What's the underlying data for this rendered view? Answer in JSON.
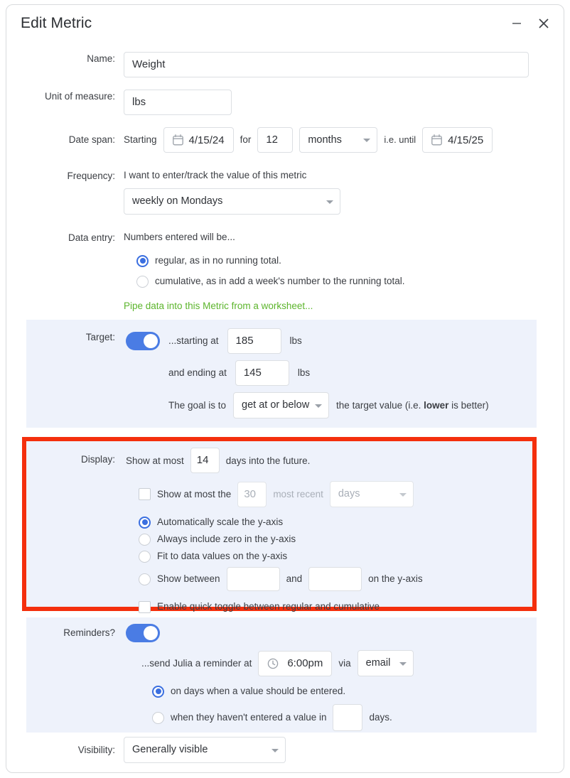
{
  "window": {
    "title": "Edit Metric",
    "minimize_icon": "minimize-icon",
    "close_icon": "close-icon"
  },
  "form": {
    "name": {
      "label": "Name:",
      "value": "Weight"
    },
    "unit": {
      "label": "Unit of measure:",
      "value": "lbs"
    },
    "date_span": {
      "label": "Date span:",
      "starting_text": "Starting",
      "start_date": "4/15/24",
      "for_text": "for",
      "duration": "12",
      "duration_unit": "months",
      "until_text": "i.e. until",
      "end_date": "4/15/25",
      "calendar_icon": "calendar-icon"
    },
    "frequency": {
      "label": "Frequency:",
      "description": "I want to enter/track the value of this metric",
      "value": "weekly on Mondays"
    },
    "data_entry": {
      "label": "Data entry:",
      "description": "Numbers entered will be...",
      "option_regular": "regular, as in no running total.",
      "option_cumulative": "cumulative, as in add a week's number to the running total.",
      "selected": "regular",
      "pipe_link": "Pipe data into this Metric from a worksheet..."
    },
    "target": {
      "label": "Target:",
      "enabled": true,
      "starting_text": "...starting at",
      "starting_value": "185",
      "starting_unit": "lbs",
      "ending_text": "and ending at",
      "ending_value": "145",
      "ending_unit": "lbs",
      "goal_text": "The goal is to",
      "goal_value": "get at or below",
      "goal_suffix_pre": "the target value (i.e. ",
      "goal_suffix_bold": "lower",
      "goal_suffix_post": " is better)"
    },
    "display": {
      "label": "Display:",
      "future_prefix": "Show at most",
      "future_days": "14",
      "future_suffix": "days into the future.",
      "recent_checkbox_checked": false,
      "recent_prefix": "Show at most the",
      "recent_count": "30",
      "recent_middle": "most recent",
      "recent_unit": "days",
      "yaxis_selected": "auto",
      "yaxis_auto": "Automatically scale the y-axis",
      "yaxis_zero": "Always include zero in the y-axis",
      "yaxis_fit": "Fit to data values on the y-axis",
      "yaxis_between_prefix": "Show between",
      "yaxis_between_min": "",
      "yaxis_between_and": "and",
      "yaxis_between_max": "",
      "yaxis_between_suffix": "on the y-axis",
      "quick_toggle_checked": false,
      "quick_toggle_label": "Enable quick toggle between regular and cumulative"
    },
    "reminders": {
      "label": "Reminders?",
      "enabled": true,
      "send_prefix": "...send Julia a reminder at",
      "time": "6:00pm",
      "via_text": "via",
      "channel": "email",
      "clock_icon": "clock-icon",
      "option_on_days": "on days when a value should be entered.",
      "option_not_entered_prefix": "when they haven't entered a value in",
      "option_not_entered_days": "",
      "option_not_entered_suffix": "days.",
      "selected": "on_days"
    },
    "visibility": {
      "label": "Visibility:",
      "value": "Generally visible"
    }
  },
  "colors": {
    "accent_blue": "#3b6fe0",
    "panel_blue": "#eef2fb",
    "highlight_red": "#f42f0d",
    "link_green": "#5cb52c"
  }
}
